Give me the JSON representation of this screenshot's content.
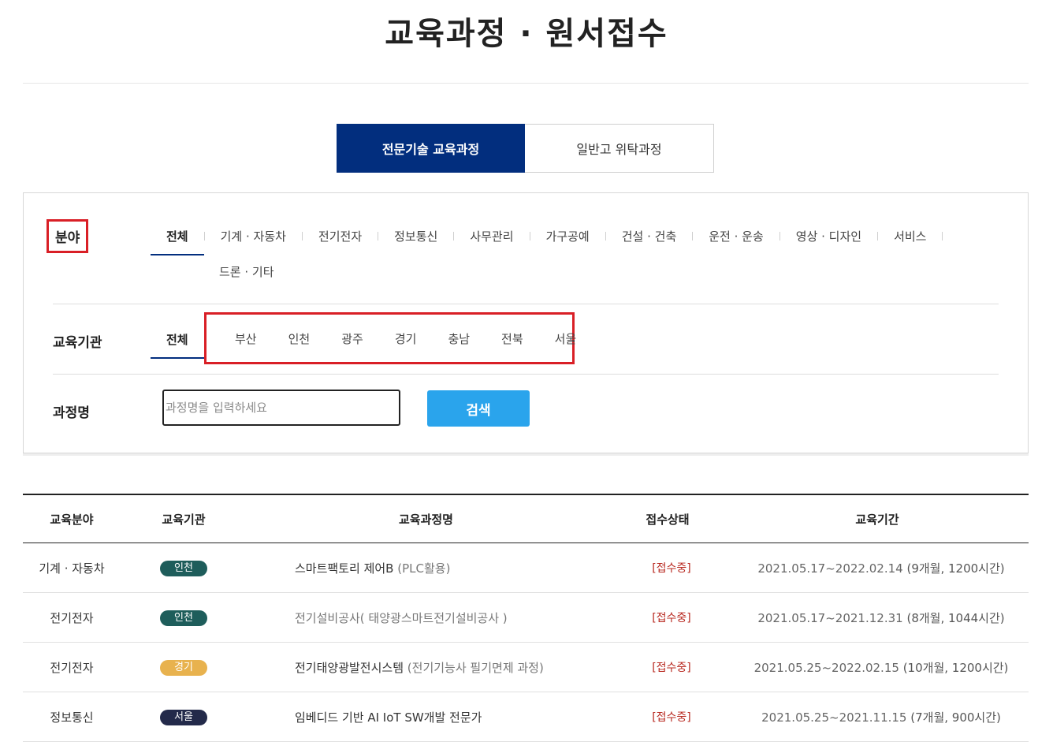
{
  "page_title": "교육과정 · 원서접수",
  "tabs": [
    {
      "label": "전문기술 교육과정",
      "active": true
    },
    {
      "label": "일반고 위탁과정",
      "active": false
    }
  ],
  "filters": {
    "field": {
      "label": "분야",
      "items": [
        "전체",
        "기계 · 자동차",
        "전기전자",
        "정보통신",
        "사무관리",
        "가구공예",
        "건설 · 건축",
        "운전 · 운송",
        "영상 · 디자인",
        "서비스",
        "드론 · 기타"
      ],
      "selected": "전체"
    },
    "institution": {
      "label": "교육기관",
      "items": [
        "전체",
        "부산",
        "인천",
        "광주",
        "경기",
        "충남",
        "전북",
        "서울"
      ],
      "selected": "전체"
    },
    "course_name": {
      "label": "과정명",
      "placeholder": "과정명을 입력하세요",
      "value": "",
      "button": "검색"
    }
  },
  "colors": {
    "navy": "#022e7e",
    "search_blue": "#2aa4ec",
    "highlight_red": "#d91f26",
    "badge_incheon": "#1e5d5b",
    "badge_gyeonggi": "#e8b24e",
    "badge_seoul": "#232a4a"
  },
  "table": {
    "headers": [
      "교육분야",
      "교육기관",
      "교육과정명",
      "접수상태",
      "교육기간"
    ],
    "rows": [
      {
        "field": "기계 · 자동차",
        "institution": "인천",
        "badge_color": "#1e5d5b",
        "course": "스마트팩토리 제어B",
        "course_sub": "(PLC활용)",
        "status": "[접수중]",
        "period": "2021.05.17~2022.02.14",
        "duration": "(9개월, 1200시간)"
      },
      {
        "field": "전기전자",
        "institution": "인천",
        "badge_color": "#1e5d5b",
        "course": "",
        "course_sub": "전기설비공사( 태양광스마트전기설비공사 )",
        "status": "[접수중]",
        "period": "2021.05.17~2021.12.31",
        "duration": "(8개월, 1044시간)"
      },
      {
        "field": "전기전자",
        "institution": "경기",
        "badge_color": "#e8b24e",
        "course": "전기태양광발전시스템",
        "course_sub": "(전기기능사 필기면제 과정)",
        "status": "[접수중]",
        "period": "2021.05.25~2022.02.15",
        "duration": "(10개월, 1200시간)"
      },
      {
        "field": "정보통신",
        "institution": "서울",
        "badge_color": "#232a4a",
        "course": "임베디드 기반 AI IoT SW개발 전문가",
        "course_sub": "",
        "status": "[접수중]",
        "period": "2021.05.25~2021.11.15",
        "duration": "(7개월, 900시간)"
      }
    ]
  }
}
